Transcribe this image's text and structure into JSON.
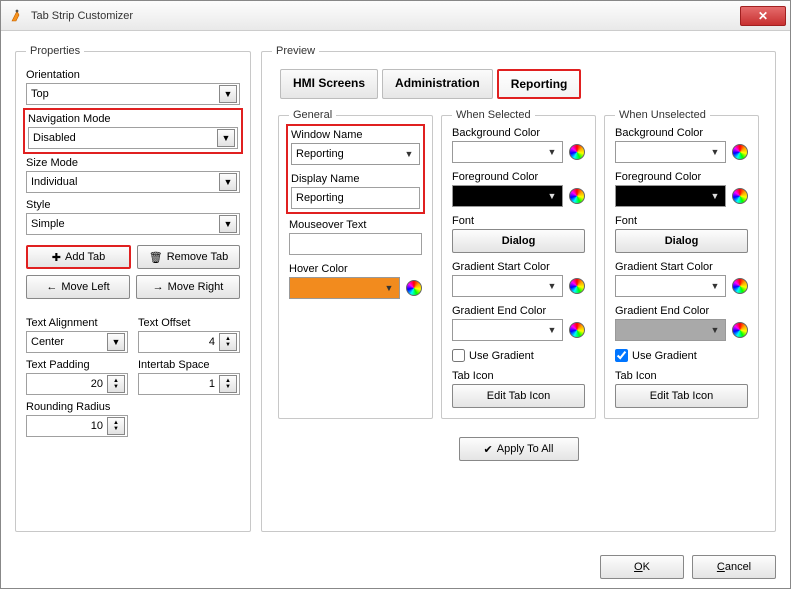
{
  "titlebar": {
    "title": "Tab Strip Customizer"
  },
  "properties": {
    "legend": "Properties",
    "orientation_label": "Orientation",
    "orientation_value": "Top",
    "nav_mode_label": "Navigation Mode",
    "nav_mode_value": "Disabled",
    "size_mode_label": "Size Mode",
    "size_mode_value": "Individual",
    "style_label": "Style",
    "style_value": "Simple",
    "add_tab": "Add Tab",
    "remove_tab": "Remove Tab",
    "move_left": "Move Left",
    "move_right": "Move Right",
    "text_align_label": "Text Alignment",
    "text_align_value": "Center",
    "text_offset_label": "Text Offset",
    "text_offset_value": "4",
    "text_padding_label": "Text Padding",
    "text_padding_value": "20",
    "intertab_label": "Intertab Space",
    "intertab_value": "1",
    "rounding_label": "Rounding Radius",
    "rounding_value": "10"
  },
  "preview": {
    "legend": "Preview",
    "tabs": [
      {
        "label": "HMI Screens",
        "selected": false
      },
      {
        "label": "Administration",
        "selected": false
      },
      {
        "label": "Reporting",
        "selected": true
      }
    ],
    "general": {
      "legend": "General",
      "window_name_label": "Window Name",
      "window_name_value": "Reporting",
      "display_name_label": "Display Name",
      "display_name_value": "Reporting",
      "mouseover_label": "Mouseover Text",
      "mouseover_value": "",
      "hover_color_label": "Hover Color"
    },
    "selected": {
      "legend": "When Selected",
      "bg_label": "Background Color",
      "fg_label": "Foreground Color",
      "font_label": "Font",
      "font_button": "Dialog",
      "grad_start_label": "Gradient Start Color",
      "grad_end_label": "Gradient End Color",
      "use_gradient_label": "Use Gradient",
      "use_gradient_checked": false,
      "tab_icon_label": "Tab Icon",
      "edit_icon_button": "Edit Tab Icon"
    },
    "unselected": {
      "legend": "When Unselected",
      "bg_label": "Background Color",
      "fg_label": "Foreground Color",
      "font_label": "Font",
      "font_button": "Dialog",
      "grad_start_label": "Gradient Start Color",
      "grad_end_label": "Gradient End Color",
      "use_gradient_label": "Use Gradient",
      "use_gradient_checked": true,
      "tab_icon_label": "Tab Icon",
      "edit_icon_button": "Edit Tab Icon"
    },
    "apply_all": "Apply To All"
  },
  "footer": {
    "ok": "OK",
    "cancel": "Cancel"
  }
}
